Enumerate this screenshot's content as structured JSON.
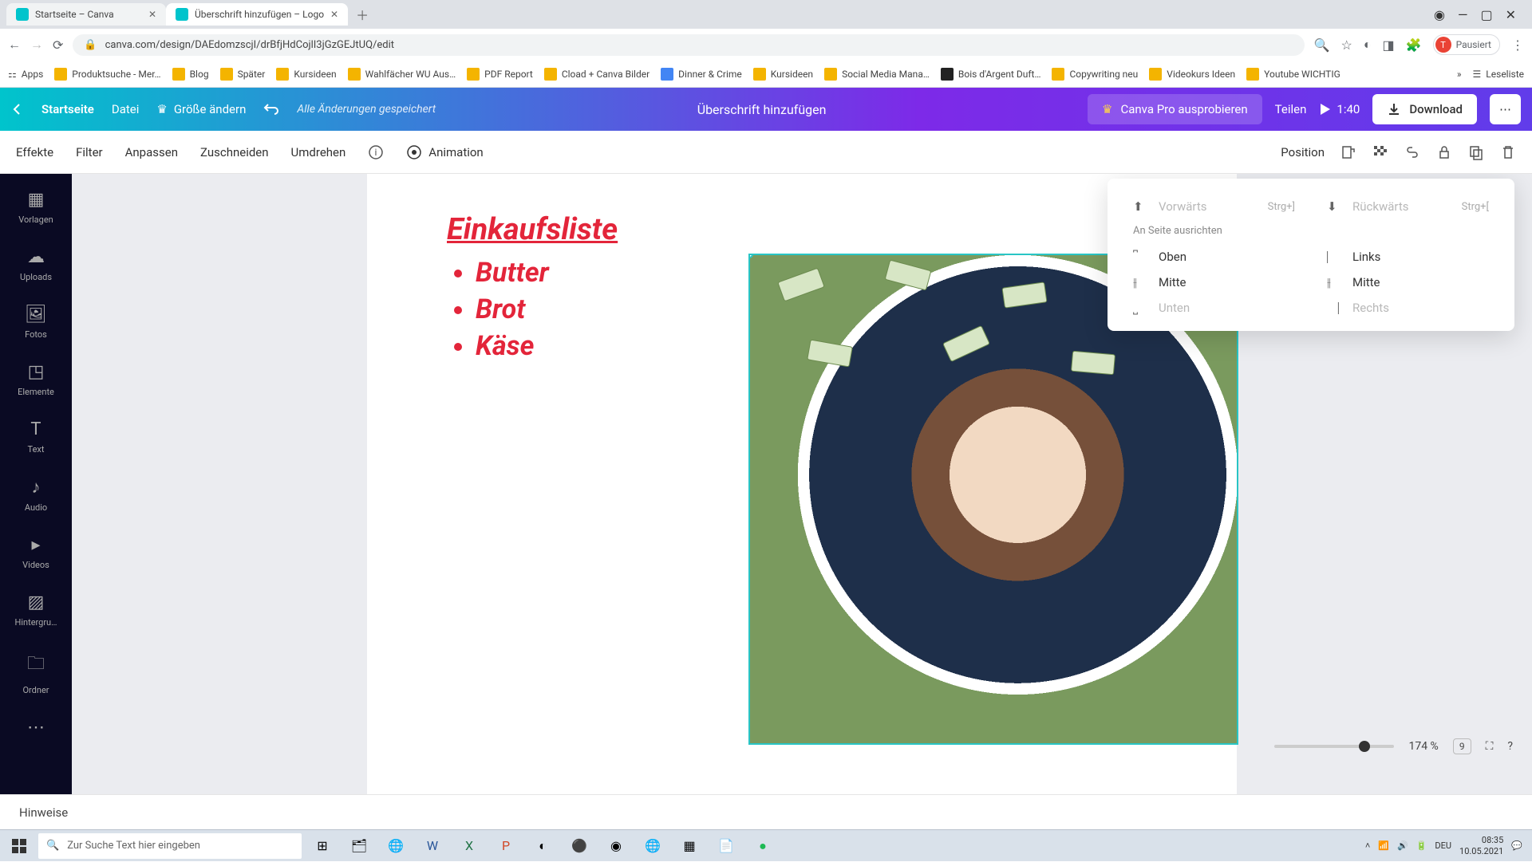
{
  "browser": {
    "tabs": [
      {
        "title": "Startseite – Canva"
      },
      {
        "title": "Überschrift hinzufügen – Logo"
      }
    ],
    "url": "canva.com/design/DAEdomzscjI/drBfjHdCojlI3jGzGEJtUQ/edit",
    "user_status": "Pausiert",
    "bookmarks": [
      "Apps",
      "Produktsuche - Mer…",
      "Blog",
      "Später",
      "Kursideen",
      "Wahlfächer WU Aus…",
      "PDF Report",
      "Cload + Canva Bilder",
      "Dinner & Crime",
      "Kursideen",
      "Social Media Mana…",
      "Bois d'Argent Duft…",
      "Copywriting neu",
      "Videokurs Ideen",
      "Youtube WICHTIG"
    ],
    "reading_list": "Leseliste"
  },
  "canva_top": {
    "home": "Startseite",
    "file": "Datei",
    "resize": "Größe ändern",
    "saved_msg": "Alle Änderungen gespeichert",
    "doc_title": "Überschrift hinzufügen",
    "try_pro": "Canva Pro ausprobieren",
    "share": "Teilen",
    "play_time": "1:40",
    "download": "Download"
  },
  "editor_bar": {
    "items": [
      "Effekte",
      "Filter",
      "Anpassen",
      "Zuschneiden",
      "Umdrehen"
    ],
    "animation": "Animation",
    "position": "Position"
  },
  "side_rail": [
    {
      "label": "Vorlagen"
    },
    {
      "label": "Uploads"
    },
    {
      "label": "Fotos"
    },
    {
      "label": "Elemente"
    },
    {
      "label": "Text"
    },
    {
      "label": "Audio"
    },
    {
      "label": "Videos"
    },
    {
      "label": "Hintergru…"
    },
    {
      "label": "Ordner"
    }
  ],
  "canvas": {
    "list_title": "Einkaufsliste",
    "list_items": [
      "Butter",
      "Brot",
      "Käse"
    ]
  },
  "position_popover": {
    "forward": "Vorwärts",
    "forward_key": "Strg+]",
    "backward": "Rückwärts",
    "backward_key": "Strg+[",
    "align_header": "An Seite ausrichten",
    "top": "Oben",
    "left": "Links",
    "middle_v": "Mitte",
    "middle_h": "Mitte",
    "bottom": "Unten",
    "right": "Rechts"
  },
  "bottom": {
    "notes": "Hinweise",
    "zoom": "174 %",
    "page_count": "9"
  },
  "taskbar": {
    "search_placeholder": "Zur Suche Text hier eingeben",
    "lang": "DEU",
    "time": "08:35",
    "date": "10.05.2021"
  }
}
